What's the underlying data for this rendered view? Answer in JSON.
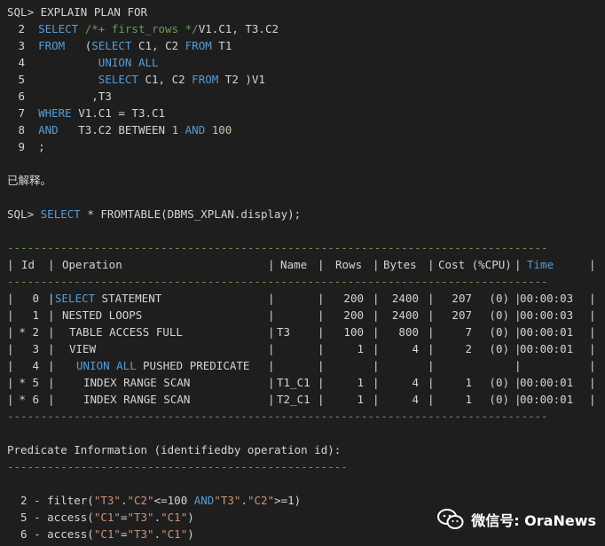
{
  "session": {
    "prompt1": "SQL> EXPLAIN PLAN FOR",
    "sql_lines": [
      {
        "n": "2",
        "parts": [
          [
            "kw",
            "SELECT "
          ],
          [
            "cm",
            "/*+ first_rows */"
          ],
          [
            "t",
            "V1.C1, T3.C2"
          ]
        ]
      },
      {
        "n": "3",
        "parts": [
          [
            "kw",
            "FROM"
          ],
          [
            "t",
            "   ("
          ],
          [
            "kw",
            "SELECT"
          ],
          [
            "t",
            " C1, C2 "
          ],
          [
            "kw",
            "FROM"
          ],
          [
            "t",
            " T1"
          ]
        ]
      },
      {
        "n": "4",
        "parts": [
          [
            "t",
            "         "
          ],
          [
            "kw",
            "UNION ALL"
          ]
        ]
      },
      {
        "n": "5",
        "parts": [
          [
            "t",
            "         "
          ],
          [
            "kw",
            "SELECT"
          ],
          [
            "t",
            " C1, C2 "
          ],
          [
            "kw",
            "FROM"
          ],
          [
            "t",
            " T2 )V1"
          ]
        ]
      },
      {
        "n": "6",
        "parts": [
          [
            "t",
            "        ,T3"
          ]
        ]
      },
      {
        "n": "7",
        "parts": [
          [
            "kw",
            "WHERE"
          ],
          [
            "t",
            " V1.C1 = T3.C1"
          ]
        ]
      },
      {
        "n": "8",
        "parts": [
          [
            "kw",
            "AND"
          ],
          [
            "t",
            "   T3.C2 BETWEEN "
          ],
          [
            "num",
            "1"
          ],
          [
            "t",
            " "
          ],
          [
            "kw",
            "AND"
          ],
          [
            "t",
            " "
          ],
          [
            "num",
            "100"
          ]
        ]
      },
      {
        "n": "9",
        "parts": [
          [
            "t",
            ";"
          ]
        ]
      }
    ],
    "explained": "已解释。",
    "prompt2_prefix": "SQL> ",
    "prompt2_kw": "SELECT",
    "prompt2_rest": " * FROMTABLE(DBMS_XPLAN.display);"
  },
  "plan_table": {
    "dashes": "---------------------------------------------------------------------------------",
    "headers": [
      "Id",
      "Operation",
      "Name",
      "Rows",
      "Bytes",
      "Cost (%CPU)",
      "Time"
    ],
    "rows": [
      {
        "id": "  0",
        "flag": " ",
        "op_kw": "SELECT",
        "op_rest": " STATEMENT",
        "indent": 0,
        "name": "",
        "rows": "200",
        "bytes": "2400",
        "cost": "207",
        "cpu": "(0)",
        "time": "00:00:03"
      },
      {
        "id": "  1",
        "flag": " ",
        "op_kw": "",
        "op_rest": "NESTED LOOPS",
        "indent": 1,
        "name": "",
        "rows": "200",
        "bytes": "2400",
        "cost": "207",
        "cpu": "(0)",
        "time": "00:00:03"
      },
      {
        "id": "* 2",
        "flag": "*",
        "op_kw": "",
        "op_rest": "TABLE ACCESS FULL",
        "indent": 2,
        "name": "T3",
        "rows": "100",
        "bytes": "800",
        "cost": "7",
        "cpu": "(0)",
        "time": "00:00:01"
      },
      {
        "id": "  3",
        "flag": " ",
        "op_kw": "",
        "op_rest": "VIEW",
        "indent": 2,
        "name": "",
        "rows": "1",
        "bytes": "4",
        "cost": "2",
        "cpu": "(0)",
        "time": "00:00:01"
      },
      {
        "id": "  4",
        "flag": " ",
        "op_kw": "UNION ALL",
        "op_rest": " PUSHED PREDICATE",
        "indent": 3,
        "name": "",
        "rows": "",
        "bytes": "",
        "cost": "",
        "cpu": "",
        "time": ""
      },
      {
        "id": "* 5",
        "flag": "*",
        "op_kw": "",
        "op_rest": "INDEX RANGE SCAN",
        "indent": 4,
        "name": "T1_C1",
        "rows": "1",
        "bytes": "4",
        "cost": "1",
        "cpu": "(0)",
        "time": "00:00:01"
      },
      {
        "id": "* 6",
        "flag": "*",
        "op_kw": "",
        "op_rest": "INDEX RANGE SCAN",
        "indent": 4,
        "name": "T2_C1",
        "rows": "1",
        "bytes": "4",
        "cost": "1",
        "cpu": "(0)",
        "time": "00:00:01"
      }
    ]
  },
  "predicates": {
    "title": "Predicate Information (identifiedby operation id):",
    "dashes": "---------------------------------------------------",
    "lines": [
      [
        [
          "t",
          "  2 - filter("
        ],
        [
          "str",
          "\"T3\""
        ],
        [
          "t",
          "."
        ],
        [
          "str",
          "\"C2\""
        ],
        [
          "t",
          "<=100 "
        ],
        [
          "kw",
          "AND"
        ],
        [
          "str",
          "\"T3\""
        ],
        [
          "t",
          "."
        ],
        [
          "str",
          "\"C2\""
        ],
        [
          "t",
          ">=1)"
        ]
      ],
      [
        [
          "t",
          "  5 - access("
        ],
        [
          "str",
          "\"C1\""
        ],
        [
          "t",
          "="
        ],
        [
          "str",
          "\"T3\""
        ],
        [
          "t",
          "."
        ],
        [
          "str",
          "\"C1\""
        ],
        [
          "t",
          ")"
        ]
      ],
      [
        [
          "t",
          "  6 - access("
        ],
        [
          "str",
          "\"C1\""
        ],
        [
          "t",
          "="
        ],
        [
          "str",
          "\"T3\""
        ],
        [
          "t",
          "."
        ],
        [
          "str",
          "\"C1\""
        ],
        [
          "t",
          ")"
        ]
      ]
    ]
  },
  "watermark": {
    "text": "微信号: OraNews",
    "icon": "wechat-icon"
  },
  "colors": {
    "background": "#1e1e1e",
    "keyword": "#569cd6",
    "comment": "#6a9955",
    "string": "#ce9178",
    "number": "#b5cea8",
    "text": "#d4d4d4"
  }
}
